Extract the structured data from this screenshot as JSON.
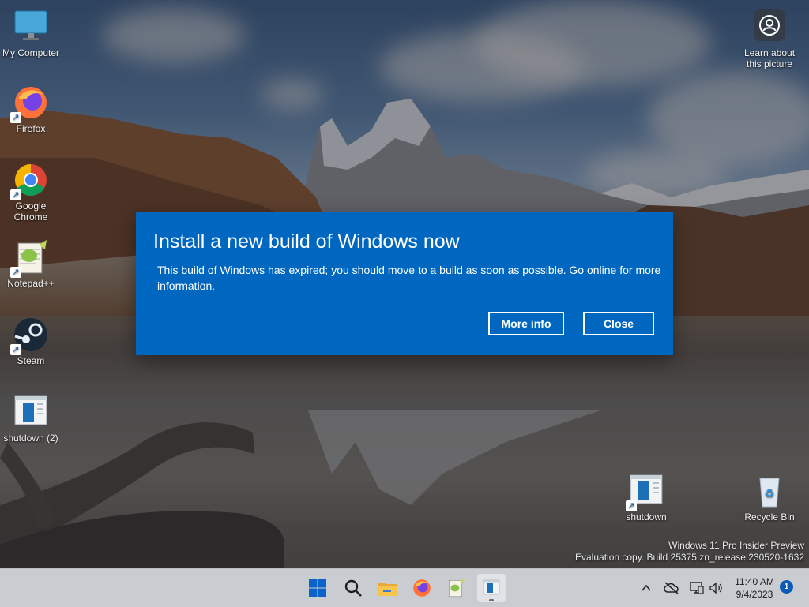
{
  "desktop": {
    "icons_left": [
      {
        "label": "My Computer",
        "icon": "monitor-icon"
      },
      {
        "label": "Firefox",
        "icon": "firefox-icon"
      },
      {
        "label": "Google Chrome",
        "icon": "chrome-icon"
      },
      {
        "label": "Notepad++",
        "icon": "notepad-plus-plus-icon"
      },
      {
        "label": "Steam",
        "icon": "steam-icon"
      },
      {
        "label": "shutdown (2)",
        "icon": "shortcut-file-icon"
      }
    ],
    "learn_about_label": "Learn about this picture",
    "shutdown_label": "shutdown",
    "recycle_bin_label": "Recycle Bin"
  },
  "dialog": {
    "title": "Install a new build of Windows now",
    "message": "This build of Windows has expired; you should move to a build as soon as possible. Go online for more information.",
    "more_info_label": "More info",
    "close_label": "Close",
    "accent": "#0067c0"
  },
  "watermark": {
    "line1": "Windows 11 Pro Insider Preview",
    "line2": "Evaluation copy. Build 25375.zn_release.230520-1632"
  },
  "taskbar": {
    "apps": [
      "start-icon",
      "search-icon",
      "file-explorer-icon",
      "firefox-icon",
      "notepad-plus-plus-icon",
      "shutdown-app-icon"
    ],
    "clock_time": "11:40 AM",
    "clock_date": "9/4/2023",
    "notification_count": "1"
  }
}
